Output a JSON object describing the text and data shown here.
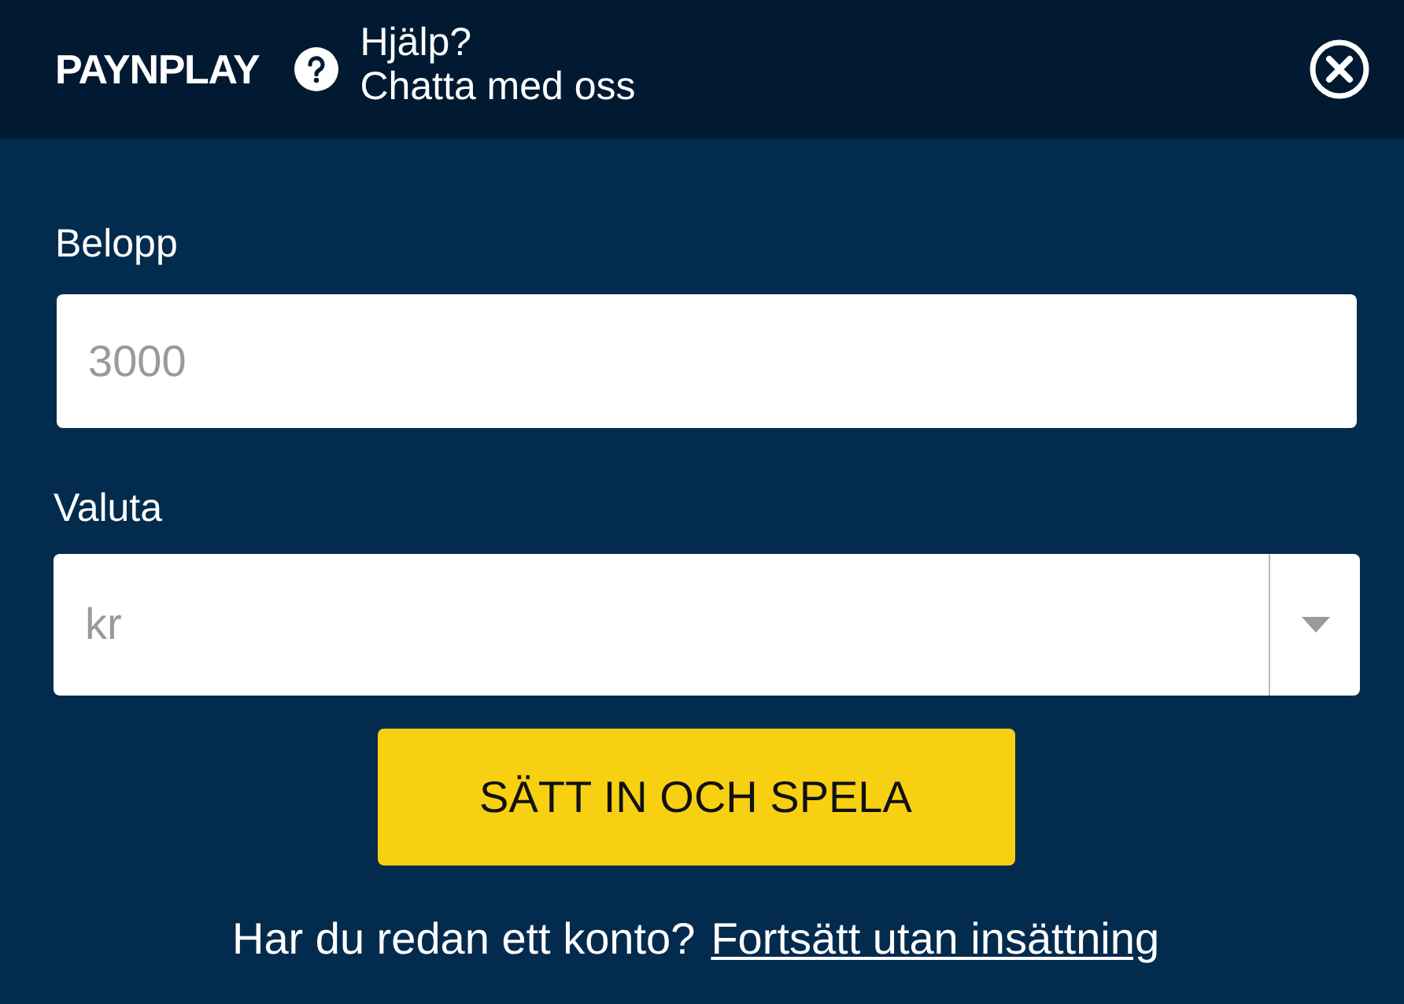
{
  "header": {
    "logo": "PAYNPLAY",
    "help_title": "Hjälp?",
    "help_subtitle": "Chatta med oss"
  },
  "amount": {
    "label": "Belopp",
    "placeholder": "3000"
  },
  "currency": {
    "label": "Valuta",
    "value": "kr"
  },
  "submit_button": "SÄTT IN OCH SPELA",
  "footer": {
    "text": "Har du redan ett konto?",
    "link": "Fortsätt utan insättning"
  }
}
